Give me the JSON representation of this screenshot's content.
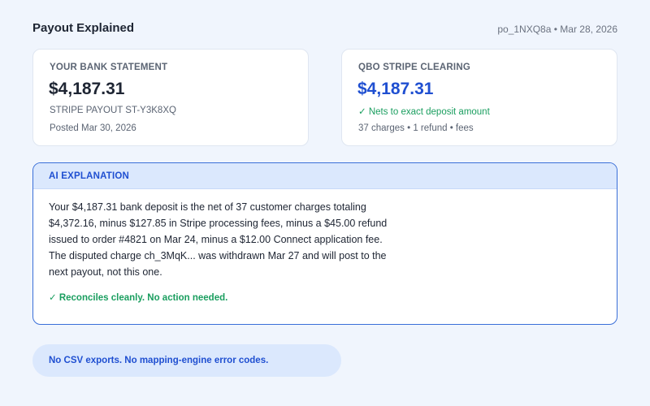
{
  "header": {
    "title": "Payout Explained",
    "meta": "po_1NXQ8a • Mar 28, 2026"
  },
  "bank_card": {
    "label": "YOUR BANK STATEMENT",
    "amount": "$4,187.31",
    "descriptor": "STRIPE PAYOUT ST-Y3K8XQ",
    "posted": "Posted Mar 30, 2026"
  },
  "qbo_card": {
    "label": "QBO STRIPE CLEARING",
    "amount": "$4,187.31",
    "status": "✓ Nets to exact deposit amount",
    "summary": "37 charges • 1 refund • fees"
  },
  "explanation": {
    "label": "AI EXPLANATION",
    "lines": [
      "Your $4,187.31 bank deposit is the net of 37 customer charges totaling",
      "$4,372.16, minus $127.85 in Stripe processing fees, minus a $45.00 refund",
      "issued to order #4821 on Mar 24, minus a $12.00 Connect application fee.",
      "The disputed charge ch_3MqK... was withdrawn Mar 27 and will post to the",
      "next payout, not this one."
    ],
    "status": "✓ Reconciles cleanly. No action needed."
  },
  "note": {
    "text": "No CSV exports. No mapping-engine error codes."
  },
  "colors": {
    "accent": "#1f4fd1",
    "success": "#1a9e5f",
    "background": "#f0f5fd"
  }
}
